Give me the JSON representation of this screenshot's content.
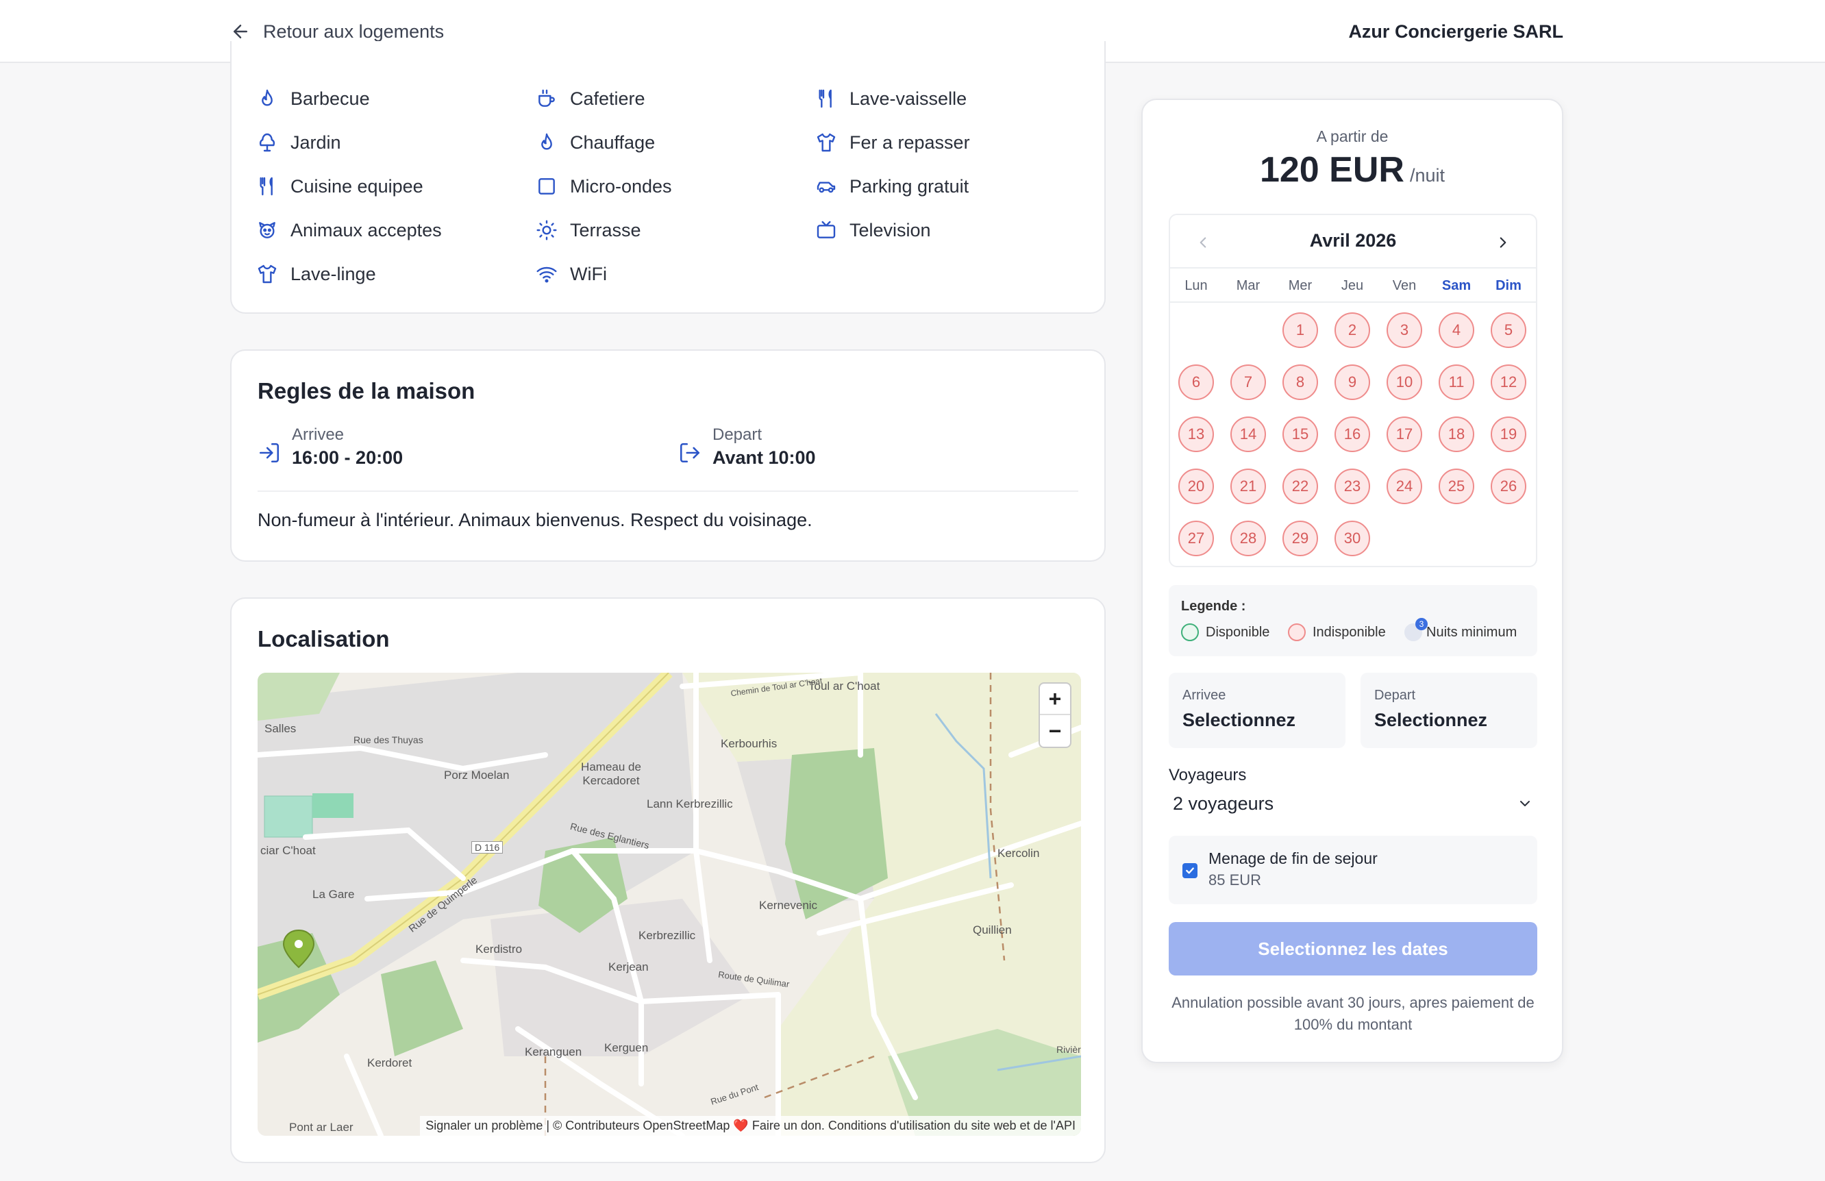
{
  "header": {
    "back_label": "Retour aux logements",
    "brand": "Azur Conciergerie SARL"
  },
  "amenities": {
    "items": [
      {
        "label": "Barbecue",
        "icon": "flame-icon"
      },
      {
        "label": "Cafetiere",
        "icon": "coffee-icon"
      },
      {
        "label": "Lave-vaisselle",
        "icon": "utensils-icon"
      },
      {
        "label": "Jardin",
        "icon": "tree-icon"
      },
      {
        "label": "Chauffage",
        "icon": "flame-icon"
      },
      {
        "label": "Fer a repasser",
        "icon": "shirt-icon"
      },
      {
        "label": "Cuisine equipee",
        "icon": "utensils-icon"
      },
      {
        "label": "Micro-ondes",
        "icon": "square-icon"
      },
      {
        "label": "Parking gratuit",
        "icon": "car-icon"
      },
      {
        "label": "Animaux acceptes",
        "icon": "paw-icon"
      },
      {
        "label": "Terrasse",
        "icon": "sun-icon"
      },
      {
        "label": "Television",
        "icon": "tv-icon"
      },
      {
        "label": "Lave-linge",
        "icon": "shirt-icon"
      },
      {
        "label": "WiFi",
        "icon": "wifi-icon"
      }
    ]
  },
  "rules": {
    "title": "Regles de la maison",
    "arrival_label": "Arrivee",
    "arrival_value": "16:00 - 20:00",
    "departure_label": "Depart",
    "departure_value": "Avant 10:00",
    "text": "Non-fumeur à l'intérieur. Animaux bienvenus. Respect du voisinage."
  },
  "location": {
    "title": "Localisation",
    "attribution": "Signaler un problème | © Contributeurs OpenStreetMap ❤️ Faire un don. Conditions d'utilisation du site web et de l'API",
    "zoom_in": "+",
    "zoom_out": "−",
    "labels": [
      "Salles",
      "Rue des Thuyas",
      "Porz Moelan",
      "Hameau de Kercadoret",
      "Rue de Quimperle",
      "Kerbourhis",
      "Toul ar C'hoat",
      "Chemin de Toul ar C'hoat",
      "Lann Kerbrezillic",
      "Rue des Eglantiers",
      "Kerbrezillic",
      "Kernevenic",
      "Kercolin",
      "Quillien",
      "Kerdistro",
      "Kerjean",
      "Route de Quilimar",
      "Keranguen",
      "Kerguen",
      "Kerdoret",
      "La Gare",
      "ciar C'hoat",
      "D 116",
      "Rue du Pont",
      "Pont ar Laer",
      "Rivière"
    ]
  },
  "booking": {
    "from_label": "A partir de",
    "price": "120 EUR",
    "per_night": "/nuit",
    "calendar": {
      "month": "Avril 2026",
      "weekdays": [
        "Lun",
        "Mar",
        "Mer",
        "Jeu",
        "Ven",
        "Sam",
        "Dim"
      ],
      "days": [
        "1",
        "2",
        "3",
        "4",
        "5",
        "6",
        "7",
        "8",
        "9",
        "10",
        "11",
        "12",
        "13",
        "14",
        "15",
        "16",
        "17",
        "18",
        "19",
        "20",
        "21",
        "22",
        "23",
        "24",
        "25",
        "26",
        "27",
        "28",
        "29",
        "30"
      ]
    },
    "legend": {
      "title": "Legende :",
      "available": "Disponible",
      "unavailable": "Indisponible",
      "min_nights": "Nuits minimum",
      "min_nights_badge": "3",
      "colors": {
        "available": "#3fb07a",
        "unavailable": "#ef8c8c",
        "min": "#c9d2ea"
      }
    },
    "arrival": {
      "label": "Arrivee",
      "value": "Selectionnez"
    },
    "departure": {
      "label": "Depart",
      "value": "Selectionnez"
    },
    "guests": {
      "label": "Voyageurs",
      "value": "2 voyageurs"
    },
    "cleaning": {
      "label": "Menage de fin de sejour",
      "price": "85 EUR",
      "checked": true
    },
    "cta": "Selectionnez les dates",
    "cancellation": "Annulation possible avant 30 jours, apres paiement de 100% du montant"
  }
}
